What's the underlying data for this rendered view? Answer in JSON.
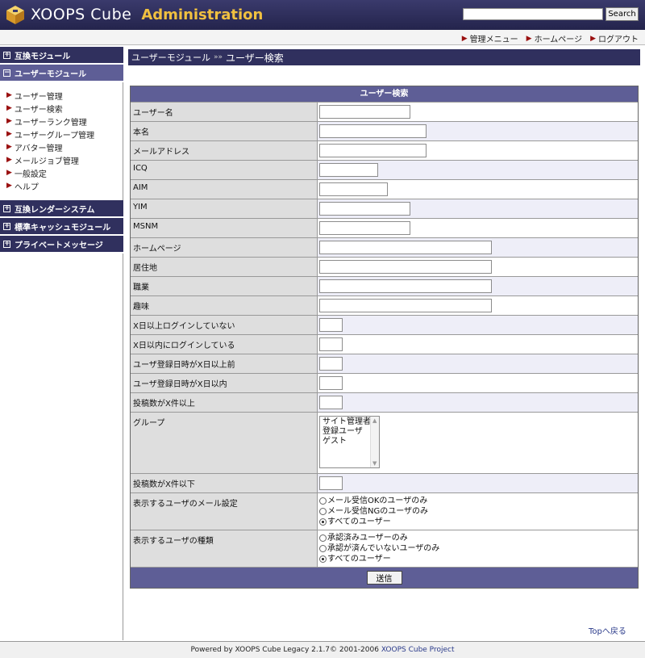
{
  "header": {
    "logo_text": "XOOPS Cube",
    "admin_text": "Administration",
    "search_value": "",
    "search_button": "Search"
  },
  "topnav": [
    "管理メニュー",
    "ホームページ",
    "ログアウト"
  ],
  "sidebar": {
    "sections": [
      {
        "label": "互換モジュール",
        "toggle": "+"
      },
      {
        "label": "ユーザーモジュール",
        "toggle": "−",
        "items": [
          "ユーザー管理",
          "ユーザー検索",
          "ユーザーランク管理",
          "ユーザーグループ管理",
          "アバター管理",
          "メールジョブ管理",
          "一般設定",
          "ヘルプ"
        ]
      },
      {
        "label": "互換レンダーシステム",
        "toggle": "+"
      },
      {
        "label": "標準キャッシュモジュール",
        "toggle": "+"
      },
      {
        "label": "プライベートメッセージ",
        "toggle": "+"
      }
    ]
  },
  "breadcrumb": {
    "parent": "ユーザーモジュール",
    "sep": "»»",
    "current": "ユーザー検索"
  },
  "form": {
    "title": "ユーザー検索",
    "fields": [
      {
        "label": "ユーザー名",
        "value": ""
      },
      {
        "label": "本名",
        "value": ""
      },
      {
        "label": "メールアドレス",
        "value": ""
      },
      {
        "label": "ICQ",
        "value": ""
      },
      {
        "label": "AIM",
        "value": ""
      },
      {
        "label": "YIM",
        "value": ""
      },
      {
        "label": "MSNM",
        "value": ""
      },
      {
        "label": "ホームページ",
        "value": ""
      },
      {
        "label": "居住地",
        "value": ""
      },
      {
        "label": "職業",
        "value": ""
      },
      {
        "label": "趣味",
        "value": ""
      },
      {
        "label": "X日以上ログインしていない",
        "value": ""
      },
      {
        "label": "X日以内にログインしている",
        "value": ""
      },
      {
        "label": "ユーザ登録日時がX日以上前",
        "value": ""
      },
      {
        "label": "ユーザ登録日時がX日以内",
        "value": ""
      },
      {
        "label": "投稿数がX件以上",
        "value": ""
      }
    ],
    "group": {
      "label": "グループ",
      "options": [
        "サイト管理者",
        "登録ユーザ",
        "ゲスト"
      ]
    },
    "posts_max": {
      "label": "投稿数がX件以下",
      "value": ""
    },
    "mail_setting": {
      "label": "表示するユーザのメール設定",
      "options": [
        "メール受信OKのユーザのみ",
        "メール受信NGのユーザのみ",
        "すべてのユーザー"
      ],
      "selected": 2
    },
    "user_type": {
      "label": "表示するユーザの種類",
      "options": [
        "承認済みユーザーのみ",
        "承認が済んでいないユーザのみ",
        "すべてのユーザー"
      ],
      "selected": 2
    },
    "submit": "送信"
  },
  "toplink": "Topへ戻る",
  "footer": {
    "prefix": "Powered by XOOPS Cube Legacy 2.1.7© 2001-2006 ",
    "project": "XOOPS Cube Project"
  }
}
